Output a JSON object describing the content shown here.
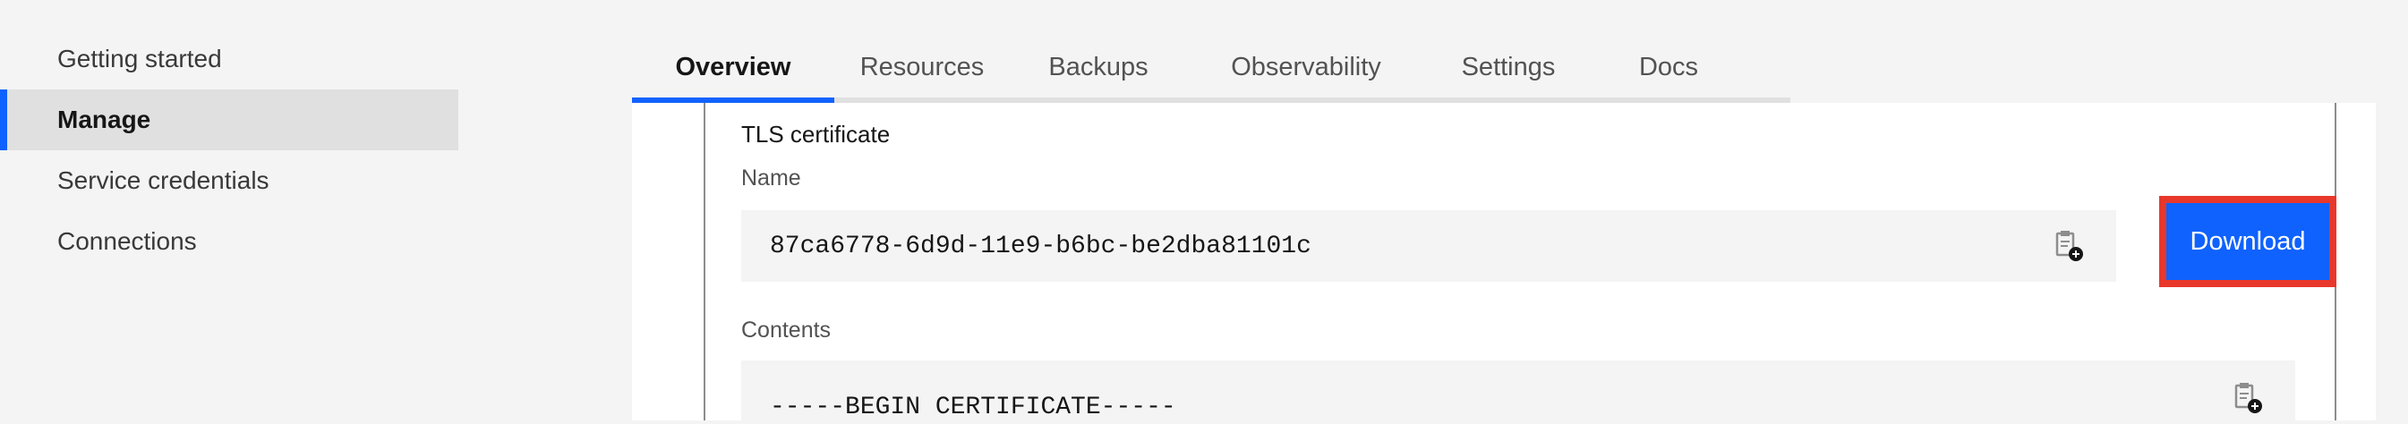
{
  "sidebar": {
    "items": [
      {
        "label": "Getting started",
        "active": false
      },
      {
        "label": "Manage",
        "active": true
      },
      {
        "label": "Service credentials",
        "active": false
      },
      {
        "label": "Connections",
        "active": false
      }
    ]
  },
  "tabs": [
    {
      "label": "Overview",
      "active": true
    },
    {
      "label": "Resources",
      "active": false
    },
    {
      "label": "Backups",
      "active": false
    },
    {
      "label": "Observability",
      "active": false
    },
    {
      "label": "Settings",
      "active": false
    },
    {
      "label": "Docs",
      "active": false
    }
  ],
  "panel": {
    "title": "TLS certificate",
    "name_label": "Name",
    "name_value": "87ca6778-6d9d-11e9-b6bc-be2dba81101c",
    "download_label": "Download",
    "contents_label": "Contents",
    "contents_value": "-----BEGIN CERTIFICATE-----"
  },
  "colors": {
    "accent": "#0f62fe",
    "highlight_border": "#e8372b",
    "sidebar_active_bg": "#e0e0e0"
  },
  "icons": {
    "copy": "copy-to-clipboard-icon"
  }
}
